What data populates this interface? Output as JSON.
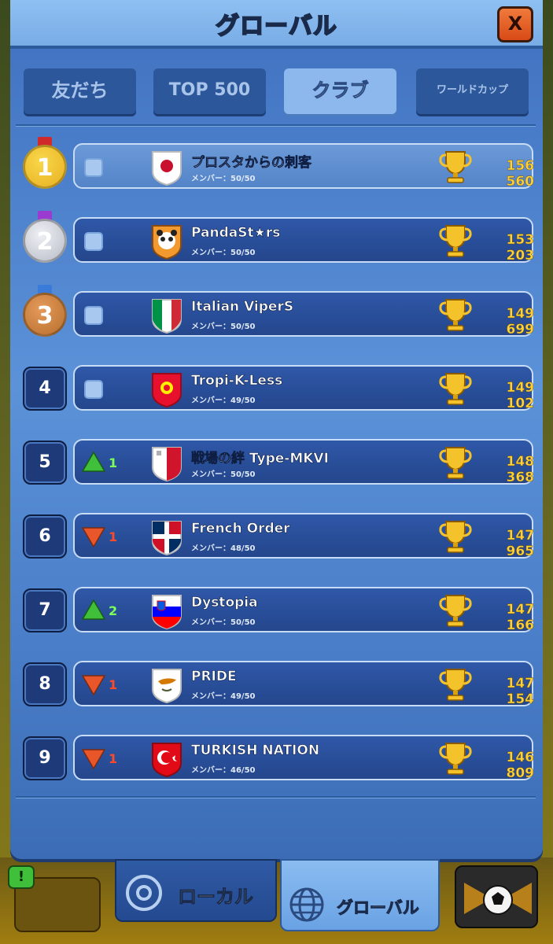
{
  "header": {
    "title": "グローバル",
    "close_label": "X"
  },
  "tabs": [
    {
      "label": "友だち",
      "active": false
    },
    {
      "label": "TOP 500",
      "active": false
    },
    {
      "label": "クラブ",
      "active": true
    },
    {
      "label": "ワールドカップ",
      "active": false
    }
  ],
  "colors": {
    "score": "#ffd23a",
    "trend_up": "#3fbf3a",
    "trend_down": "#e8562a",
    "gold": "#e8b82a",
    "silver": "#c8ccd4",
    "bronze": "#c07a3a"
  },
  "rows": [
    {
      "rank": "1",
      "medal": "gold",
      "trend": "none",
      "trend_value": "",
      "flag": "japan",
      "name": "プロスタからの刺客",
      "members": "メンバー：50/50",
      "score": "156 560"
    },
    {
      "rank": "2",
      "medal": "silver",
      "trend": "none",
      "trend_value": "",
      "flag": "panda-crest",
      "name": "PandaSt★rs",
      "members": "メンバー：50/50",
      "score": "153 203"
    },
    {
      "rank": "3",
      "medal": "bronze",
      "trend": "none",
      "trend_value": "",
      "flag": "italy",
      "name": "Italian ViperS",
      "members": "メンバー：50/50",
      "score": "149 699"
    },
    {
      "rank": "4",
      "medal": "",
      "trend": "none",
      "trend_value": "",
      "flag": "kyrgyzstan",
      "name": "Tropi-K-Less",
      "members": "メンバー：49/50",
      "score": "149 102"
    },
    {
      "rank": "5",
      "medal": "",
      "trend": "up",
      "trend_value": "1",
      "flag": "malta",
      "name": "戦場の絆 Type-MKVI",
      "members": "メンバー：50/50",
      "score": "148 368"
    },
    {
      "rank": "6",
      "medal": "",
      "trend": "down",
      "trend_value": "1",
      "flag": "dominican-republic",
      "name": "French Order",
      "members": "メンバー：48/50",
      "score": "147 965"
    },
    {
      "rank": "7",
      "medal": "",
      "trend": "up",
      "trend_value": "2",
      "flag": "slovenia",
      "name": "Dystopia",
      "members": "メンバー：50/50",
      "score": "147 166"
    },
    {
      "rank": "8",
      "medal": "",
      "trend": "down",
      "trend_value": "1",
      "flag": "cyprus",
      "name": "PRIDE",
      "members": "メンバー：49/50",
      "score": "147 154"
    },
    {
      "rank": "9",
      "medal": "",
      "trend": "down",
      "trend_value": "1",
      "flag": "turkey",
      "name": "TURKISH NATION",
      "members": "メンバー：46/50",
      "score": "146 809"
    }
  ],
  "bottom_nav": [
    {
      "label": "ローカル",
      "icon": "target-icon",
      "active": false
    },
    {
      "label": "グローバル",
      "icon": "globe-icon",
      "active": true
    }
  ],
  "alert_badge": "!"
}
